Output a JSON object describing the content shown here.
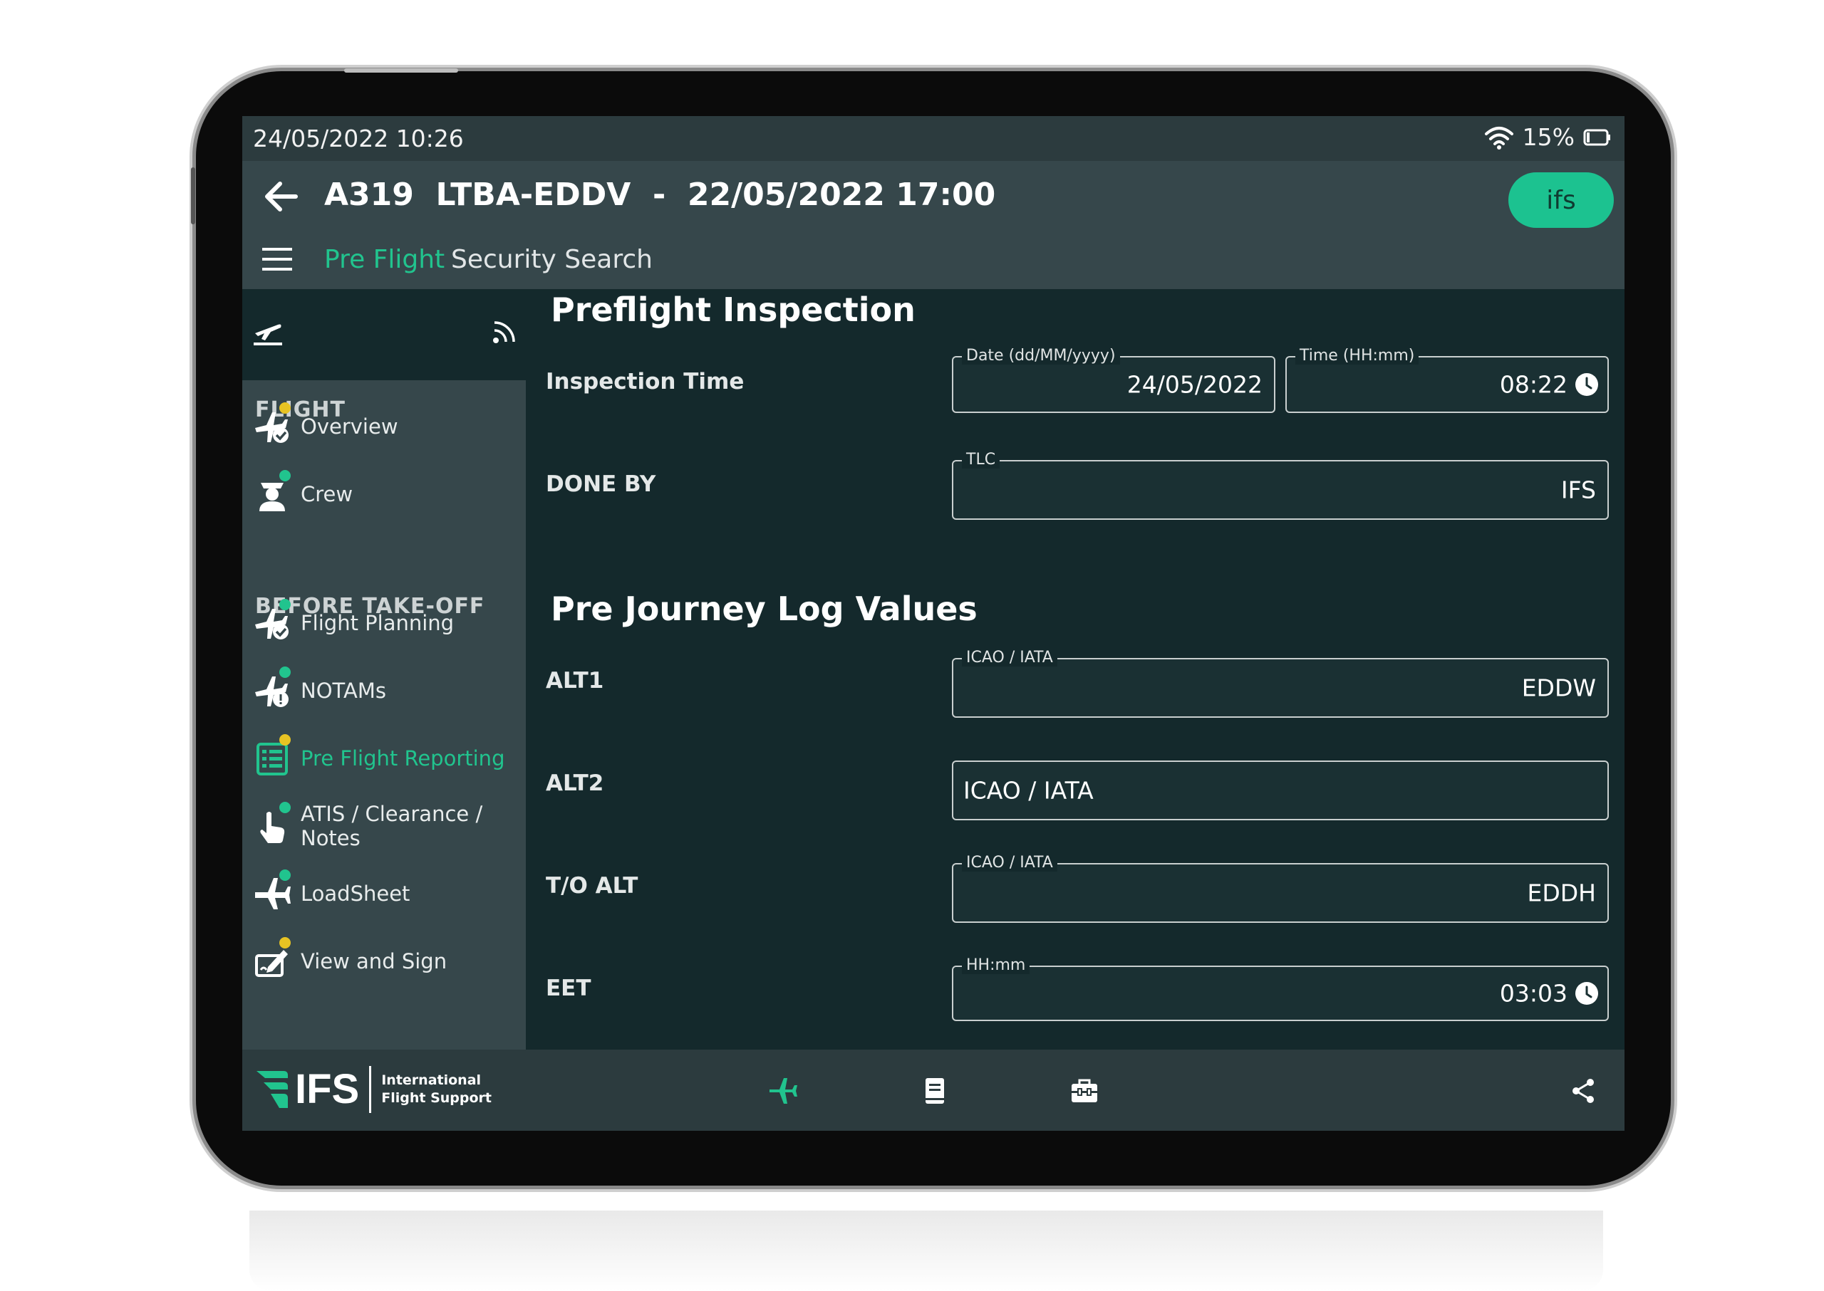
{
  "status_bar": {
    "datetime": "24/05/2022 10:26",
    "battery": "15%"
  },
  "header": {
    "title": "A319  LTBA-EDDV  -  22/05/2022 17:00",
    "badge": "ifs"
  },
  "tabs": [
    {
      "label": "Pre Flight",
      "active": true
    },
    {
      "label": "Security Search",
      "active": false
    }
  ],
  "sidebar": {
    "sections": [
      {
        "label": "FLIGHT",
        "items": [
          {
            "label": "Overview",
            "icon": "plane-check-icon",
            "status": "warning"
          },
          {
            "label": "Crew",
            "icon": "pilot-icon",
            "status": "ok"
          }
        ]
      },
      {
        "label": "BEFORE TAKE-OFF",
        "items": [
          {
            "label": "Flight Planning",
            "icon": "plane-check-icon",
            "status": "ok"
          },
          {
            "label": "NOTAMs",
            "icon": "plane-alert-icon",
            "status": "ok"
          },
          {
            "label": "Pre Flight Reporting",
            "icon": "list-icon",
            "status": "warning",
            "active": true
          },
          {
            "label": "ATIS / Clearance / Notes",
            "icon": "hand-pointer-icon",
            "status": "ok"
          },
          {
            "label": "LoadSheet",
            "icon": "plane-icon",
            "status": "ok"
          },
          {
            "label": "View and Sign",
            "icon": "sign-icon",
            "status": "warning"
          }
        ]
      }
    ]
  },
  "main": {
    "inspection_heading": "Preflight Inspection",
    "inspection_time": {
      "label": "Inspection Time",
      "date_legend": "Date (dd/MM/yyyy)",
      "date_value": "24/05/2022",
      "time_legend": "Time (HH:mm)",
      "time_value": "08:22"
    },
    "done_by": {
      "label": "DONE BY",
      "legend": "TLC",
      "value": "IFS"
    },
    "journey_heading": "Pre Journey Log Values",
    "alt1": {
      "label": "ALT1",
      "legend": "ICAO / IATA",
      "value": "EDDW"
    },
    "alt2": {
      "label": "ALT2",
      "placeholder": "ICAO / IATA"
    },
    "to_alt": {
      "label": "T/O ALT",
      "legend": "ICAO / IATA",
      "value": "EDDH"
    },
    "eet": {
      "label": "EET",
      "legend": "HH:mm",
      "value": "03:03"
    }
  },
  "footer": {
    "logo_text": "IFS",
    "logo_sub_line1": "International",
    "logo_sub_line2": "Flight Support"
  },
  "colors": {
    "accent": "#21c48e",
    "warning": "#e7c323",
    "background": "#14292c",
    "panel": "#36474b"
  }
}
